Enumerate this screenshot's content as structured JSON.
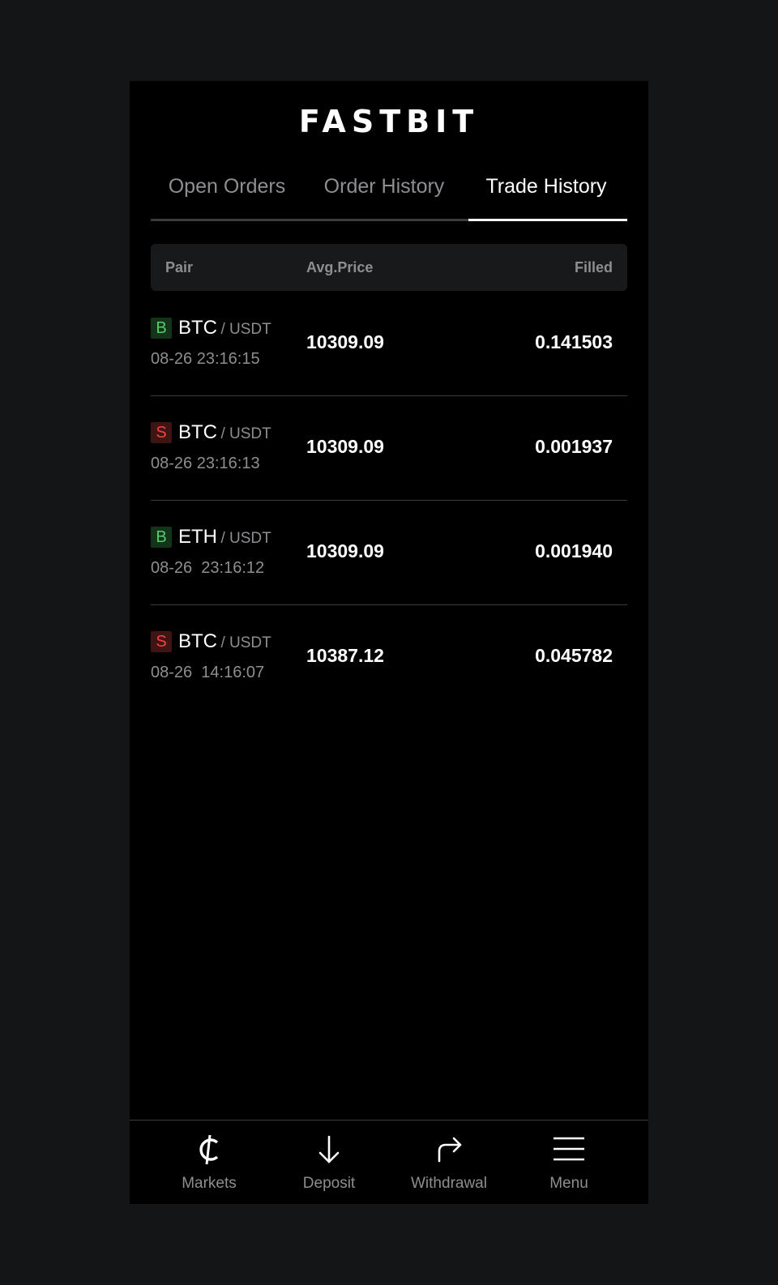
{
  "app": {
    "brand": "FASTBIT"
  },
  "tabs": [
    {
      "label": "Open Orders",
      "active": false
    },
    {
      "label": "Order History",
      "active": false
    },
    {
      "label": "Trade History",
      "active": true
    }
  ],
  "table": {
    "headers": {
      "pair": "Pair",
      "avg_price": "Avg.Price",
      "filled": "Filled"
    },
    "rows": [
      {
        "side": "B",
        "side_type": "buy",
        "base": "BTC",
        "quote": "/ USDT",
        "time": "08-26 23:16:15",
        "avg_price": "10309.09",
        "filled": "0.141503"
      },
      {
        "side": "S",
        "side_type": "sell",
        "base": "BTC",
        "quote": "/ USDT",
        "time": "08-26 23:16:13",
        "avg_price": "10309.09",
        "filled": "0.001937"
      },
      {
        "side": "B",
        "side_type": "buy",
        "base": "ETH",
        "quote": "/ USDT",
        "time": "08-26  23:16:12",
        "avg_price": "10309.09",
        "filled": "0.001940"
      },
      {
        "side": "S",
        "side_type": "sell",
        "base": "BTC",
        "quote": "/ USDT",
        "time": "08-26  14:16:07",
        "avg_price": "10387.12",
        "filled": "0.045782"
      }
    ]
  },
  "bottom_nav": [
    {
      "label": "Markets",
      "icon": "cedi-currency-icon"
    },
    {
      "label": "Deposit",
      "icon": "arrow-down-icon"
    },
    {
      "label": "Withdrawal",
      "icon": "share-arrow-icon"
    },
    {
      "label": "Menu",
      "icon": "hamburger-menu-icon"
    }
  ],
  "colors": {
    "page_background": "#141517",
    "app_background": "#000000",
    "buy": "#4fcf6a",
    "sell": "#f0443e",
    "muted_text": "#8d8e92"
  }
}
